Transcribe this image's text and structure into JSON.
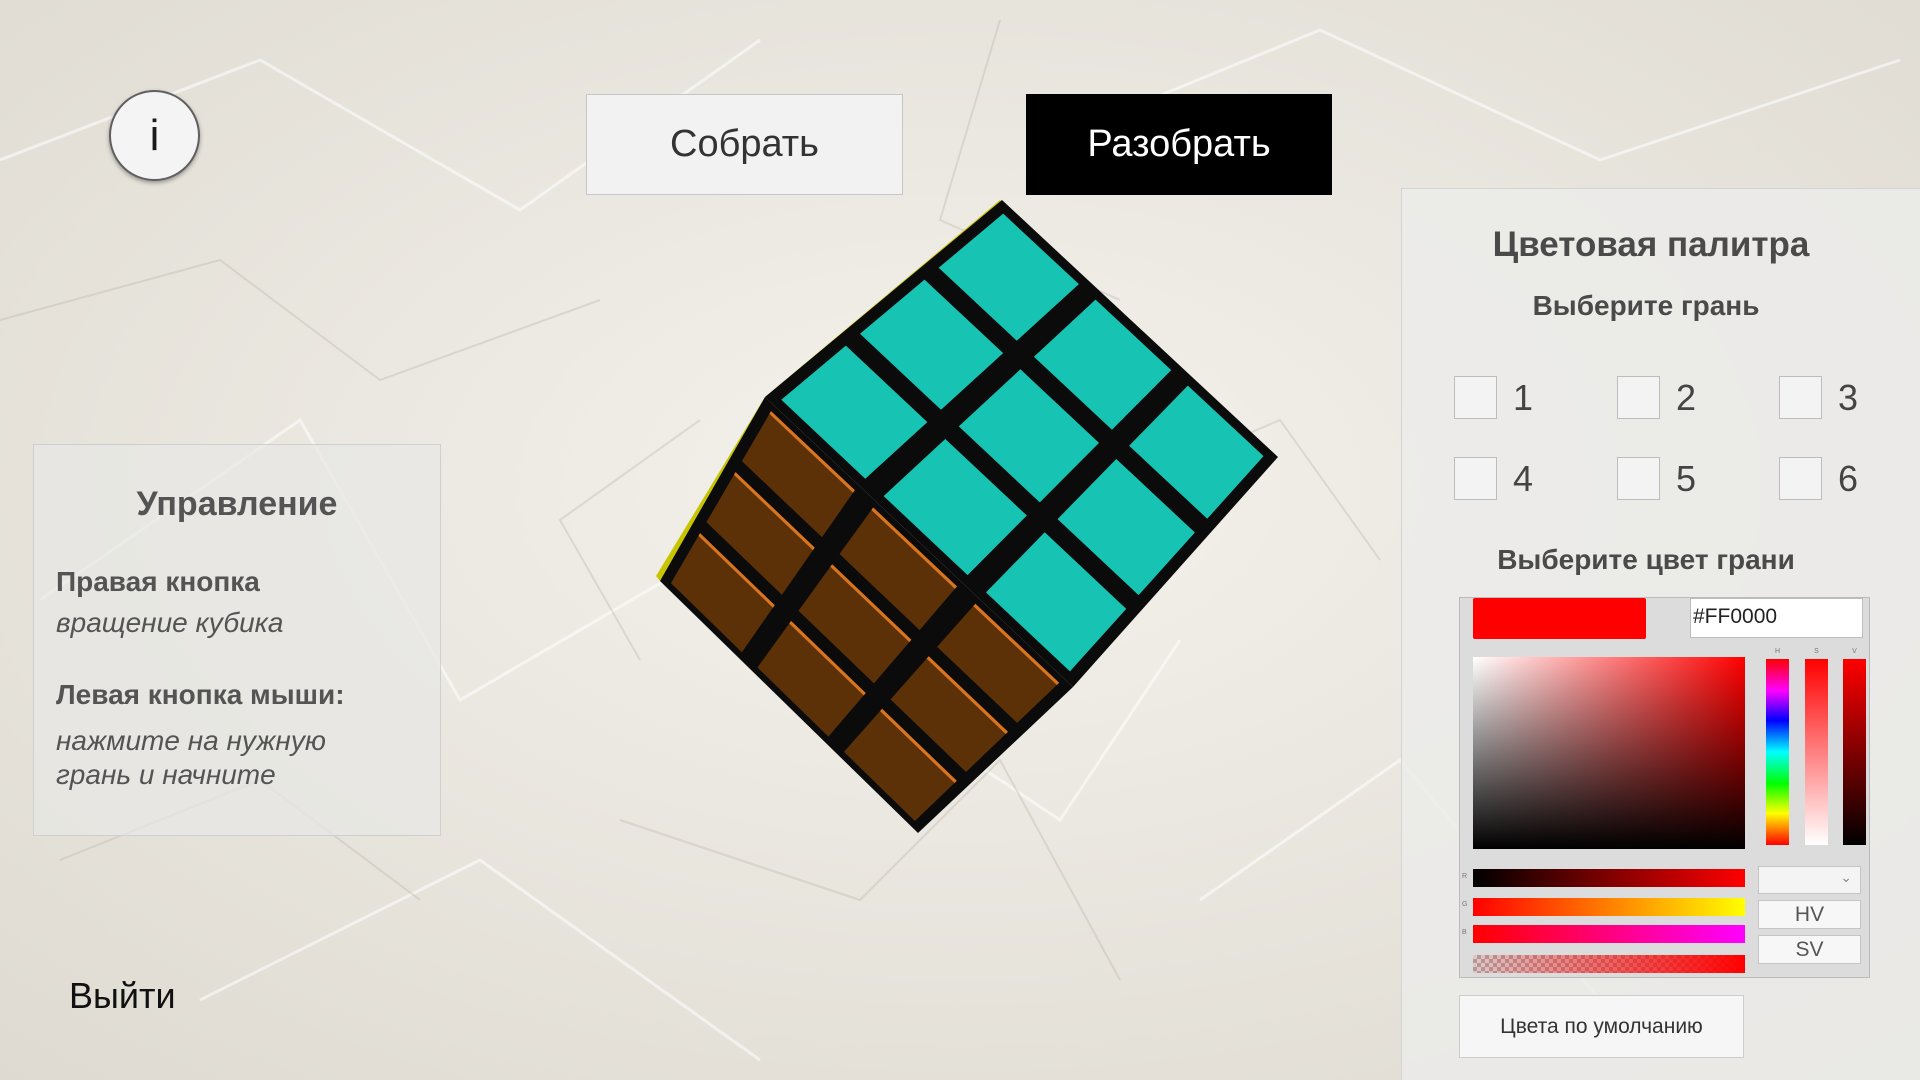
{
  "header": {
    "solve_label": "Собрать",
    "scramble_label": "Разобрать",
    "info_label": "i"
  },
  "controls": {
    "title": "Управление",
    "right_button_label": "Правая кнопка",
    "right_button_desc": "вращение кубика",
    "left_button_label": "Левая кнопка мыши:",
    "left_button_desc_line1": "нажмите на нужную",
    "left_button_desc_line2": "грань и начните"
  },
  "exit_label": "Выйти",
  "palette": {
    "title": "Цветовая палитра",
    "choose_face": "Выберите грань",
    "faces": [
      "1",
      "2",
      "3",
      "4",
      "5",
      "6"
    ],
    "choose_color": "Выберите цвет грани",
    "hex_value": "#FF0000",
    "current_color": "#ff0000",
    "bar_labels": {
      "h": "H",
      "s": "S",
      "v": "V",
      "r": "R",
      "g": "G",
      "b": "B"
    },
    "mode_buttons": [
      "HV",
      "SV"
    ],
    "default_colors_label": "Цвета по умолчанию"
  },
  "cube": {
    "top_face_color": "#17c4b3",
    "front_face_color": "#5c3107",
    "front_edge_color": "#d9741f",
    "left_edge_color": "#c8c400",
    "grid_color": "#0b0b0b"
  }
}
